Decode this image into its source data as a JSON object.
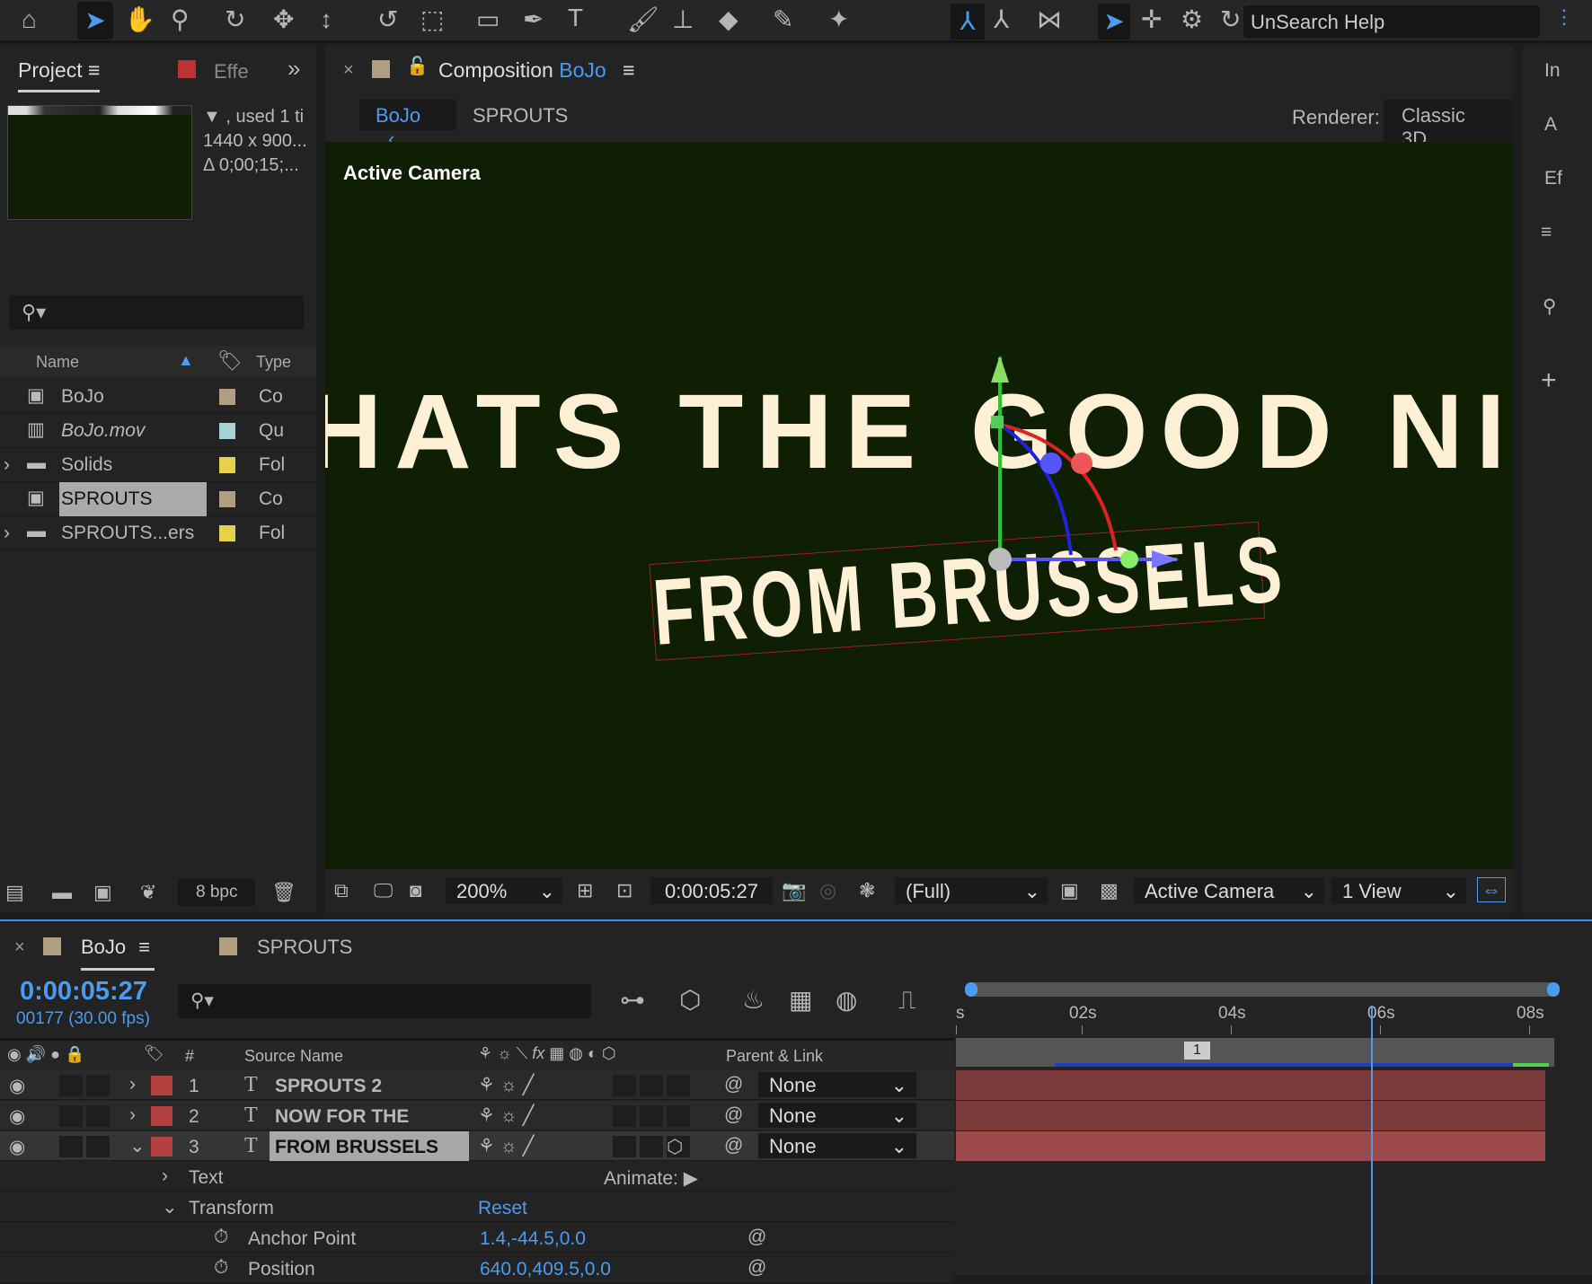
{
  "toolbar": {
    "search_label": "Search Help",
    "search_prefix": "Un",
    "icons": [
      "home-icon",
      "selection-icon",
      "hand-icon",
      "zoom-icon",
      "rotate-icon",
      "pan-behind-icon",
      "unified-camera-icon",
      "orbit-icon",
      "region-icon",
      "rectangle-icon",
      "pen-icon",
      "type-icon",
      "brush-icon",
      "clone-stamp-icon",
      "eraser-icon",
      "roto-brush-icon",
      "puppet-pin-icon"
    ]
  },
  "project": {
    "tab": "Project",
    "effects_tab": "Effe",
    "used": ", used 1 ti",
    "dimensions": "1440 x 900...",
    "duration": "Δ 0;00;15;...",
    "columns": {
      "name": "Name",
      "type": "Type"
    },
    "items": [
      {
        "name": "BoJo",
        "type": "Co",
        "color": "#b19e80",
        "kind": "comp"
      },
      {
        "name": "BoJo.mov",
        "type": "Qu",
        "color": "#a6d3d3",
        "kind": "footage"
      },
      {
        "name": "Solids",
        "type": "Fol",
        "color": "#e6d14a",
        "kind": "folder"
      },
      {
        "name": "SPROUTS",
        "type": "Co",
        "color": "#b19e80",
        "kind": "comp",
        "selected": true
      },
      {
        "name": "SPROUTS...ers",
        "type": "Fol",
        "color": "#e6d14a",
        "kind": "folder"
      }
    ],
    "bpc": "8 bpc"
  },
  "composition": {
    "tab_prefix": "Composition",
    "tab_name": "BoJo",
    "breadcrumbs": [
      "BoJo",
      "SPROUTS"
    ],
    "renderer_label": "Renderer:",
    "renderer": "Classic 3D",
    "view_label": "Active Camera",
    "line1": "HATS THE GOOD NI",
    "line1_italic": "GOOD",
    "line2": "FROM BRUSSELS",
    "zoom": "200%",
    "timecode": "0:00:05:27",
    "resolution": "(Full)",
    "camera": "Active Camera",
    "views": "1 View"
  },
  "right_panel": {
    "tabs": [
      "In",
      "A",
      "Ef"
    ]
  },
  "timeline": {
    "tabs": [
      "BoJo",
      "SPROUTS"
    ],
    "timecode": "0:00:05:27",
    "frame": "00177 (30.00 fps)",
    "columns": {
      "num": "#",
      "source": "Source Name",
      "parent": "Parent & Link"
    },
    "ruler": [
      "s",
      "02s",
      "04s",
      "06s",
      "08s"
    ],
    "marker": "1",
    "playhead_fraction": 0.7,
    "layers": [
      {
        "num": "1",
        "name": "SPROUTS 2",
        "parent": "None"
      },
      {
        "num": "2",
        "name": "NOW FOR THE",
        "parent": "None"
      },
      {
        "num": "3",
        "name": "FROM BRUSSELS",
        "parent": "None",
        "selected": true
      }
    ],
    "text_group": "Text",
    "animate": "Animate:",
    "transform": "Transform",
    "reset": "Reset",
    "props": [
      {
        "name": "Anchor Point",
        "value": "1.4,-44.5,0.0"
      },
      {
        "name": "Position",
        "value": "640.0,409.5,0.0"
      }
    ]
  }
}
